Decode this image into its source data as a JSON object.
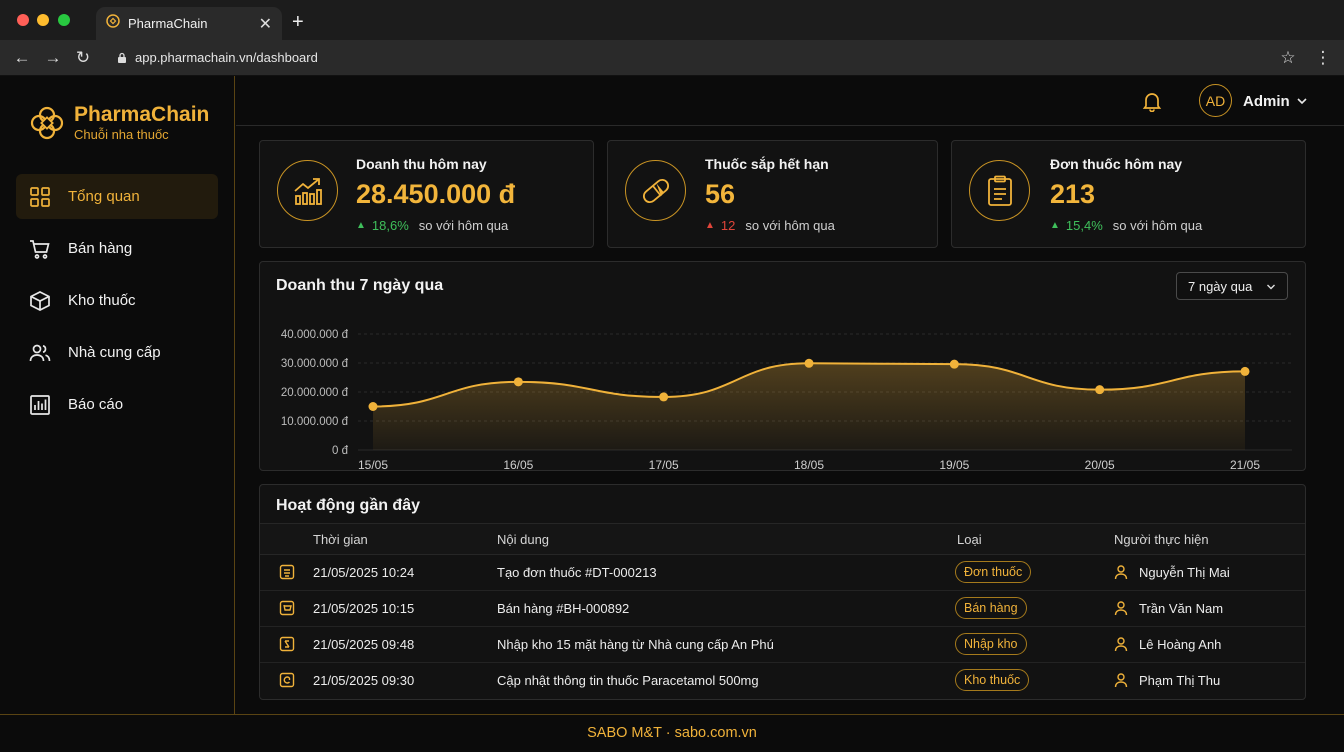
{
  "browser": {
    "tab_title": "PharmaChain",
    "url": "app.pharmachain.vn/dashboard"
  },
  "brand": {
    "name": "PharmaChain",
    "subtitle": "Chuỗi nha thuốc"
  },
  "sidebar": {
    "items": [
      {
        "label": "Tổng quan",
        "icon": "grid-icon",
        "active": true
      },
      {
        "label": "Bán hàng",
        "icon": "cart-icon",
        "active": false
      },
      {
        "label": "Kho thuốc",
        "icon": "box-icon",
        "active": false
      },
      {
        "label": "Nhà cung cấp",
        "icon": "users-icon",
        "active": false
      },
      {
        "label": "Báo cáo",
        "icon": "report-icon",
        "active": false
      }
    ]
  },
  "header": {
    "avatar_initials": "AD",
    "user_name": "Admin"
  },
  "stats": [
    {
      "title": "Doanh thu hôm nay",
      "value": "28.450.000 đ",
      "trend": "18,6%",
      "trend_dir": "up",
      "trend_text": "so với hôm qua",
      "icon": "revenue-chart-icon"
    },
    {
      "title": "Thuốc sắp hết hạn",
      "value": "56",
      "trend": "12",
      "trend_dir": "up-red",
      "trend_text": "so với hôm qua",
      "icon": "pill-icon"
    },
    {
      "title": "Đơn thuốc hôm nay",
      "value": "213",
      "trend": "15,4%",
      "trend_dir": "up",
      "trend_text": "so với hôm qua",
      "icon": "clipboard-icon"
    }
  ],
  "chart_section": {
    "title": "Doanh thu 7 ngày qua",
    "range": "7 ngày qua"
  },
  "chart_data": {
    "type": "area",
    "categories": [
      "15/05",
      "16/05",
      "17/05",
      "18/05",
      "19/05",
      "20/05",
      "21/05"
    ],
    "values": [
      15000000,
      23500000,
      18300000,
      29900000,
      29600000,
      20800000,
      27100000
    ],
    "y_ticks": [
      "0 đ",
      "10.000.000 đ",
      "20.000.000 đ",
      "30.000.000 đ",
      "40.000.000 đ"
    ],
    "ylim": [
      0,
      40000000
    ],
    "color": "#f0b23a",
    "grid": true
  },
  "activity": {
    "title": "Hoạt động gần đây",
    "columns": [
      "Thời gian",
      "Nội dung",
      "Loại",
      "Người thực hiện"
    ],
    "rows": [
      {
        "time": "21/05/2025 10:24",
        "content": "Tạo đơn thuốc #DT-000213",
        "type": "Đơn thuốc",
        "user": "Nguyễn Thị Mai"
      },
      {
        "time": "21/05/2025 10:15",
        "content": "Bán hàng #BH-000892",
        "type": "Bán hàng",
        "user": "Trần Văn Nam"
      },
      {
        "time": "21/05/2025 09:48",
        "content": "Nhập kho 15 mặt hàng từ Nhà cung cấp An Phú",
        "type": "Nhập kho",
        "user": "Lê Hoàng Anh"
      },
      {
        "time": "21/05/2025 09:30",
        "content": "Cập nhật thông tin thuốc Paracetamol 500mg",
        "type": "Kho thuốc",
        "user": "Phạm Thị Thu"
      }
    ]
  },
  "footer": {
    "text": "SABO M&T · sabo.com.vn"
  }
}
